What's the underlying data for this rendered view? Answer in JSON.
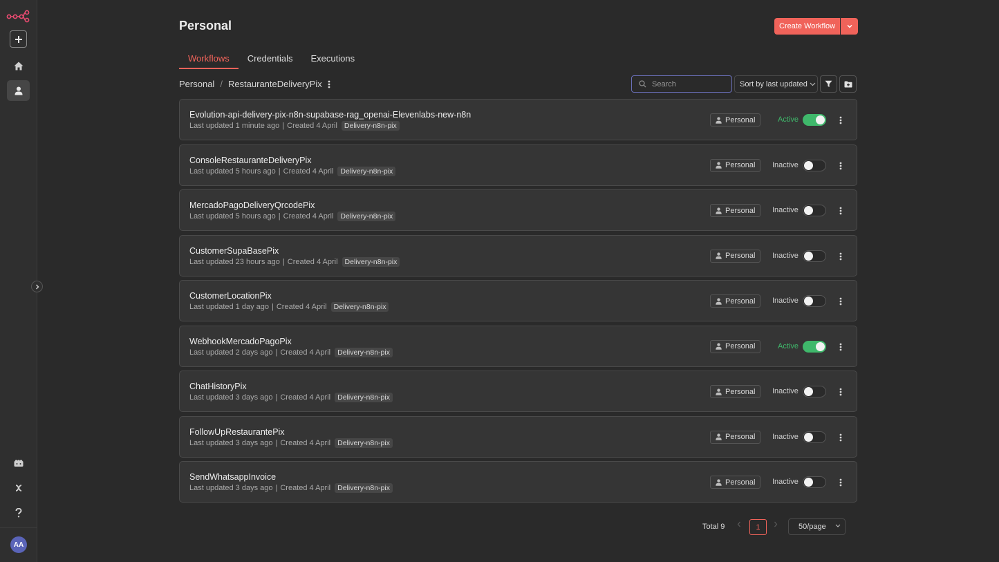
{
  "sidebar": {
    "logo_icon": "n8n-logo-icon",
    "avatar_initials": "AA"
  },
  "header": {
    "title": "Personal",
    "create_label": "Create Workflow"
  },
  "tabs": [
    {
      "label": "Workflows",
      "active": true
    },
    {
      "label": "Credentials",
      "active": false
    },
    {
      "label": "Executions",
      "active": false
    }
  ],
  "breadcrumb": {
    "root": "Personal",
    "folder": "RestauranteDeliveryPix"
  },
  "toolbar": {
    "search_placeholder": "Search",
    "sort_label": "Sort by last updated"
  },
  "workflows": [
    {
      "name": "Evolution-api-delivery-pix-n8n-supabase-rag_openai-Elevenlabs-new-n8n",
      "updated": "Last updated 1 minute ago",
      "created": "Created 4 April",
      "tag": "Delivery-n8n-pix",
      "owner": "Personal",
      "status": "Active",
      "active": true
    },
    {
      "name": "ConsoleRestauranteDeliveryPix",
      "updated": "Last updated 5 hours ago",
      "created": "Created 4 April",
      "tag": "Delivery-n8n-pix",
      "owner": "Personal",
      "status": "Inactive",
      "active": false
    },
    {
      "name": "MercadoPagoDeliveryQrcodePix",
      "updated": "Last updated 5 hours ago",
      "created": "Created 4 April",
      "tag": "Delivery-n8n-pix",
      "owner": "Personal",
      "status": "Inactive",
      "active": false
    },
    {
      "name": "CustomerSupaBasePix",
      "updated": "Last updated 23 hours ago",
      "created": "Created 4 April",
      "tag": "Delivery-n8n-pix",
      "owner": "Personal",
      "status": "Inactive",
      "active": false
    },
    {
      "name": "CustomerLocationPix",
      "updated": "Last updated 1 day ago",
      "created": "Created 4 April",
      "tag": "Delivery-n8n-pix",
      "owner": "Personal",
      "status": "Inactive",
      "active": false
    },
    {
      "name": "WebhookMercadoPagoPix",
      "updated": "Last updated 2 days ago",
      "created": "Created 4 April",
      "tag": "Delivery-n8n-pix",
      "owner": "Personal",
      "status": "Active",
      "active": true
    },
    {
      "name": "ChatHistoryPix",
      "updated": "Last updated 3 days ago",
      "created": "Created 4 April",
      "tag": "Delivery-n8n-pix",
      "owner": "Personal",
      "status": "Inactive",
      "active": false
    },
    {
      "name": "FollowUpRestaurantePix",
      "updated": "Last updated 3 days ago",
      "created": "Created 4 April",
      "tag": "Delivery-n8n-pix",
      "owner": "Personal",
      "status": "Inactive",
      "active": false
    },
    {
      "name": "SendWhatsappInvoice",
      "updated": "Last updated 3 days ago",
      "created": "Created 4 April",
      "tag": "Delivery-n8n-pix",
      "owner": "Personal",
      "status": "Inactive",
      "active": false
    }
  ],
  "pagination": {
    "total": "Total 9",
    "current_page": "1",
    "page_size": "50/page"
  },
  "colors": {
    "accent": "#f0635a",
    "active_green": "#3fb86b"
  }
}
